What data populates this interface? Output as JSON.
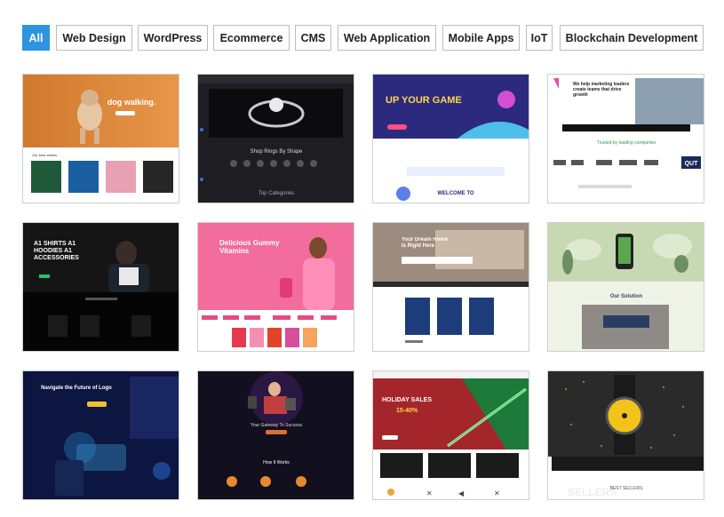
{
  "filters": [
    {
      "label": "All",
      "active": true
    },
    {
      "label": "Web Design",
      "active": false
    },
    {
      "label": "WordPress",
      "active": false
    },
    {
      "label": "Ecommerce",
      "active": false
    },
    {
      "label": "CMS",
      "active": false
    },
    {
      "label": "Web Application",
      "active": false
    },
    {
      "label": "Mobile Apps",
      "active": false
    },
    {
      "label": "IoT",
      "active": false
    },
    {
      "label": "Blockchain Development",
      "active": false
    }
  ],
  "portfolio": [
    {
      "name": "dog-walking-site",
      "headline": "dog walking.",
      "sub": "Our best sellers"
    },
    {
      "name": "jewelry-store-site",
      "headline": "Shop Rings By Shape",
      "sub": "Top Categories"
    },
    {
      "name": "gaming-site",
      "headline": "UP YOUR GAME",
      "sub": "WELCOME TO"
    },
    {
      "name": "marketing-agency-site",
      "headline": "We help marketing leaders create teams that drive growth",
      "sub": "Trusted by leading companies",
      "logo": "QUT"
    },
    {
      "name": "apparel-store-site",
      "headline": "A1 SHIRTS A1 HOODIES A1 ACCESSORIES",
      "sub": ""
    },
    {
      "name": "gummy-vitamins-site",
      "headline": "Delicious Gummy Vitamins",
      "sub": ""
    },
    {
      "name": "real-estate-site",
      "headline": "Your Dream Home Is Right Here",
      "sub": ""
    },
    {
      "name": "mobile-app-site",
      "headline": "Our Solution",
      "sub": ""
    },
    {
      "name": "logo-design-site",
      "headline": "Navigate the Future of Logo",
      "sub": ""
    },
    {
      "name": "digital-agency-site",
      "headline": "Your Gateway To Success",
      "sub": "How It Works"
    },
    {
      "name": "lightsaber-store-site",
      "headline": "HOLIDAY SALES",
      "sub": "15-40%"
    },
    {
      "name": "watch-store-site",
      "headline": "BEST SELLERS",
      "sub": "SELLERS"
    }
  ],
  "colors": {
    "accent": "#2d95e0",
    "border": "#bdbdbd"
  }
}
